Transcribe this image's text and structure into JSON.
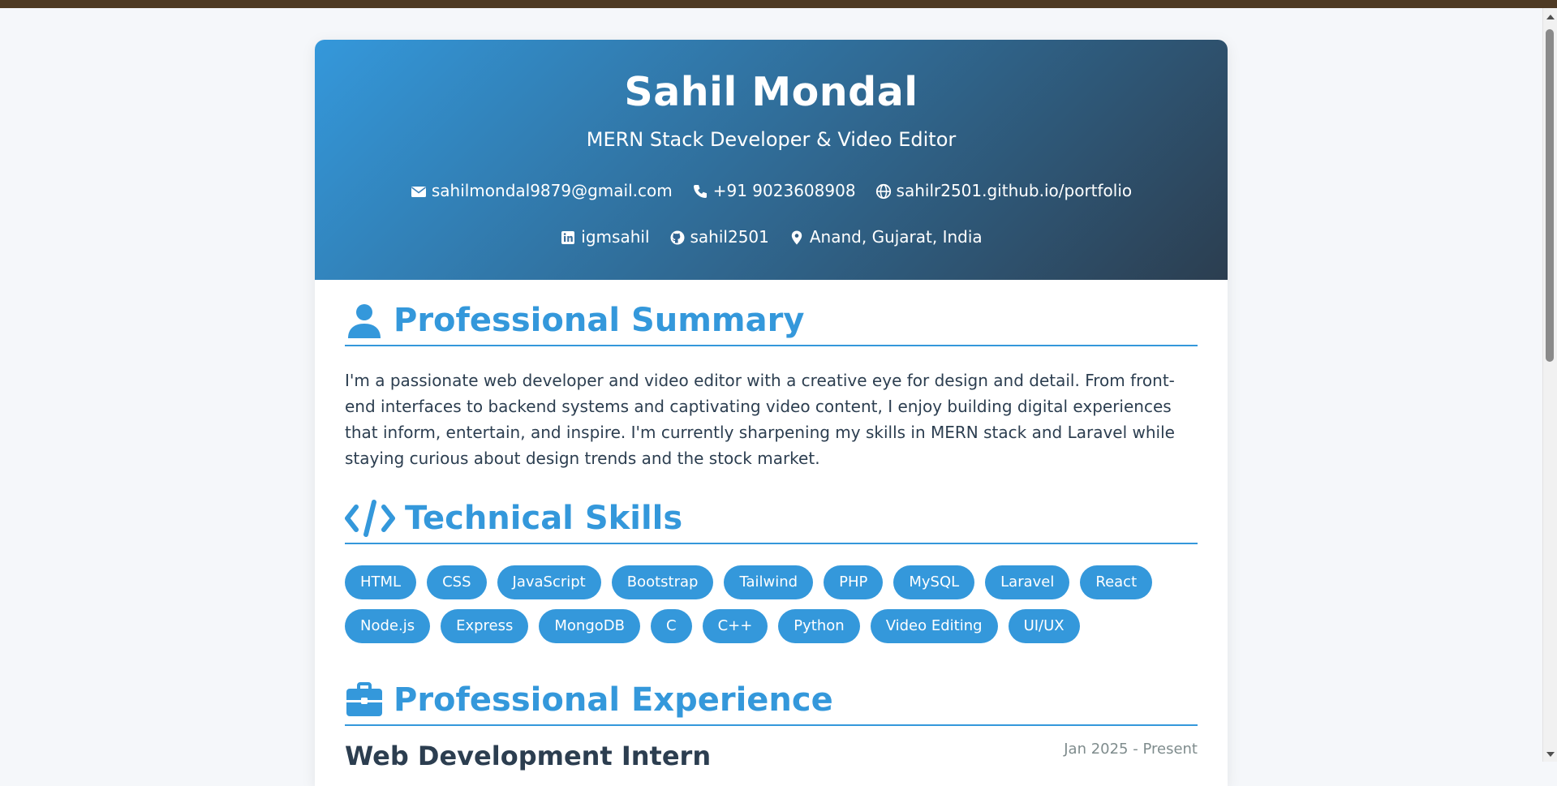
{
  "header": {
    "name": "Sahil Mondal",
    "title": "MERN Stack Developer & Video Editor",
    "contacts": [
      {
        "icon": "envelope-icon",
        "text": "sahilmondal9879@gmail.com"
      },
      {
        "icon": "phone-icon",
        "text": "+91 9023608908"
      },
      {
        "icon": "globe-icon",
        "text": "sahilr2501.github.io/portfolio"
      },
      {
        "icon": "linkedin-icon",
        "text": "igmsahil"
      },
      {
        "icon": "github-icon",
        "text": "sahil2501"
      },
      {
        "icon": "map-marker-icon",
        "text": "Anand, Gujarat, India"
      }
    ]
  },
  "summary": {
    "heading": "Professional Summary",
    "icon": "user-icon",
    "text": "I'm a passionate web developer and video editor with a creative eye for design and detail. From front-end interfaces to backend systems and captivating video content, I enjoy building digital experiences that inform, entertain, and inspire. I'm currently sharpening my skills in MERN stack and Laravel while staying curious about design trends and the stock market."
  },
  "skills": {
    "heading": "Technical Skills",
    "icon": "code-icon",
    "items": [
      "HTML",
      "CSS",
      "JavaScript",
      "Bootstrap",
      "Tailwind",
      "PHP",
      "MySQL",
      "Laravel",
      "React",
      "Node.js",
      "Express",
      "MongoDB",
      "C",
      "C++",
      "Python",
      "Video Editing",
      "UI/UX"
    ]
  },
  "experience": {
    "heading": "Professional Experience",
    "icon": "briefcase-icon",
    "first_role": "Web Development Intern",
    "first_date": "Jan 2025 - Present"
  },
  "colors": {
    "accent": "#3498db",
    "dark": "#2c3e50",
    "topbar": "#4e3a24"
  }
}
